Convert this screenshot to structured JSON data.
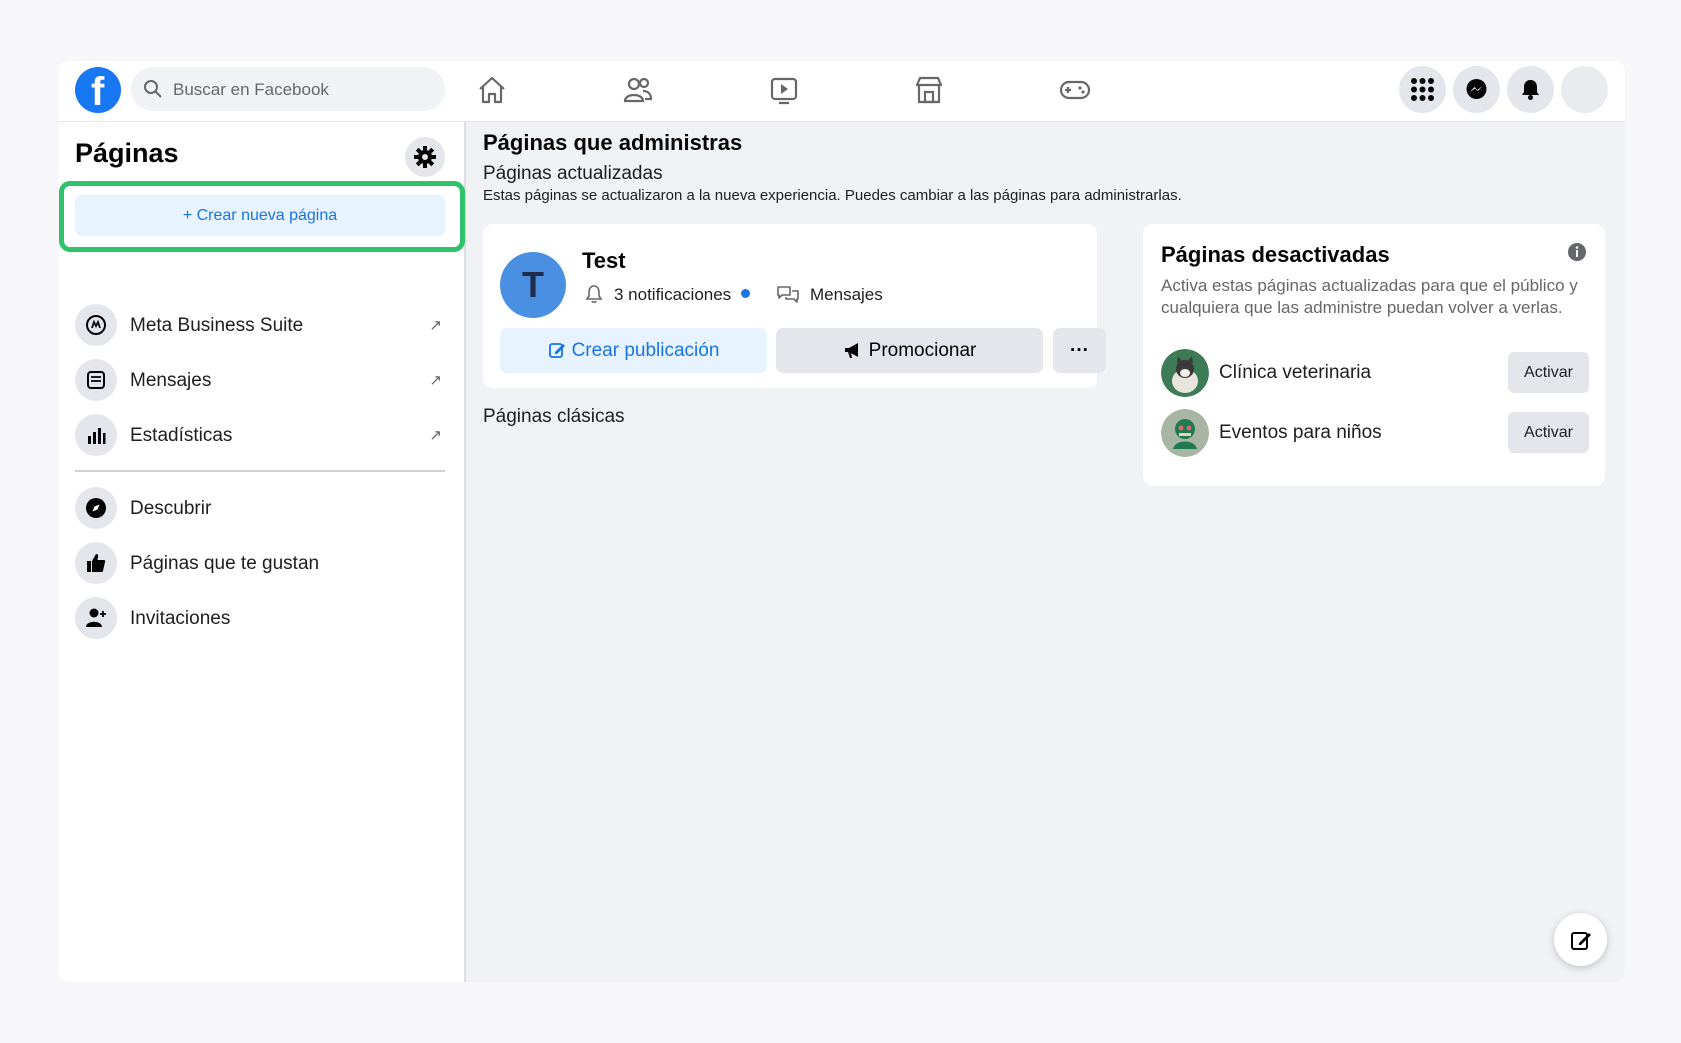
{
  "topbar": {
    "search_placeholder": "Buscar en Facebook",
    "nav": [
      "home-icon",
      "friends-icon",
      "watch-icon",
      "marketplace-icon",
      "gaming-icon"
    ],
    "right": [
      "menu-grid-icon",
      "messenger-icon",
      "notifications-icon",
      "profile-avatar"
    ]
  },
  "sidebar": {
    "title": "Páginas",
    "create_label": "+ Crear nueva página",
    "items": [
      {
        "label": "Meta Business Suite",
        "icon": "meta-business-suite-icon",
        "external": "↗"
      },
      {
        "label": "Mensajes",
        "icon": "inbox-icon",
        "external": "↗"
      },
      {
        "label": "Estadísticas",
        "icon": "insights-icon",
        "external": "↗"
      },
      {
        "label": "Descubrir",
        "icon": "compass-icon"
      },
      {
        "label": "Páginas que te gustan",
        "icon": "thumbs-up-icon"
      },
      {
        "label": "Invitaciones",
        "icon": "person-add-icon"
      }
    ]
  },
  "main": {
    "title": "Páginas que administras",
    "subtitle": "Páginas actualizadas",
    "description": "Estas páginas se actualizaron a la nueva experiencia. Puedes cambiar a las páginas para administrarlas.",
    "page": {
      "initial": "T",
      "name": "Test",
      "notifications": "3 notificaciones",
      "messages": "Mensajes",
      "create_post": "Crear publicación",
      "promote": "Promocionar",
      "more": "···"
    },
    "classic_title": "Páginas clásicas"
  },
  "deactivated": {
    "title": "Páginas desactivadas",
    "description": "Activa estas páginas actualizadas para que el público y cualquiera que las administre puedan volver a verlas.",
    "pages": [
      {
        "name": "Clínica veterinaria",
        "button": "Activar"
      },
      {
        "name": "Eventos para niños",
        "button": "Activar"
      }
    ]
  },
  "colors": {
    "brand": "#1877f2",
    "accent_text": "#1b74e4",
    "highlight_border": "#2ec36b"
  }
}
